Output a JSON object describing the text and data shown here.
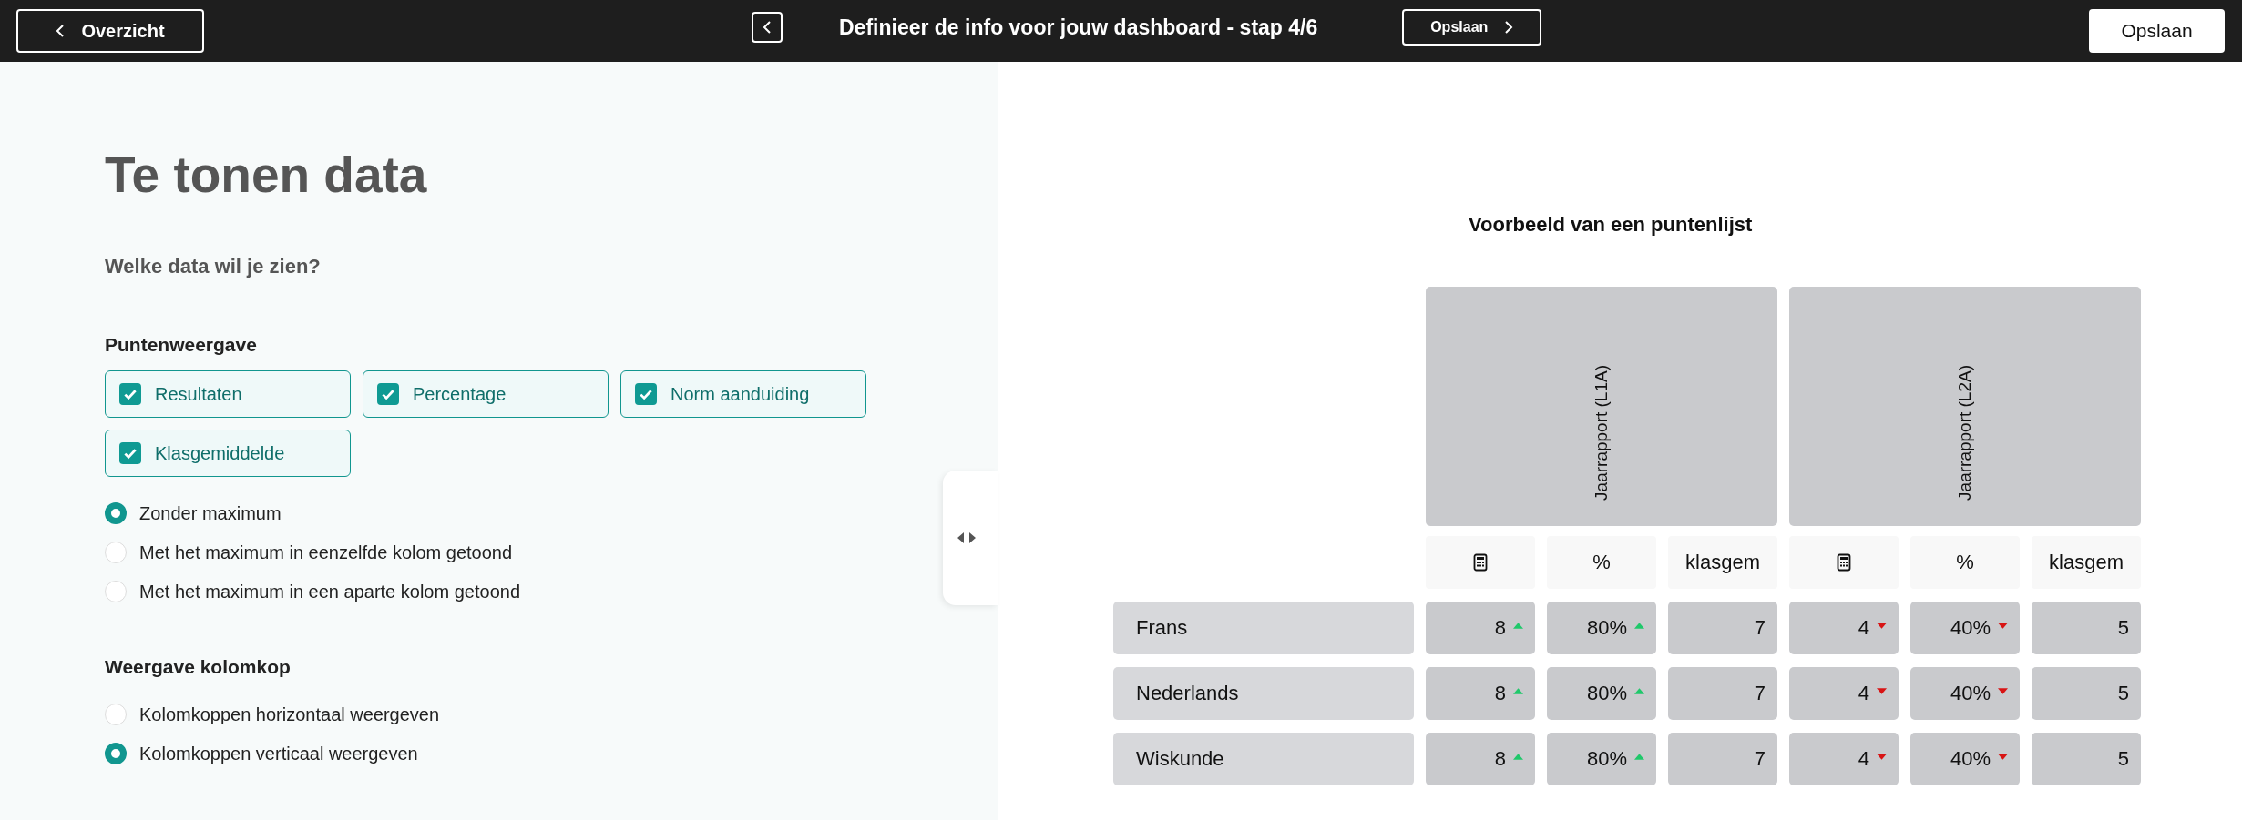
{
  "topbar": {
    "back_label": "Overzicht",
    "title": "Definieer de info voor jouw dashboard - stap 4/6",
    "next_label": "Opslaan",
    "save_label": "Opslaan"
  },
  "settings": {
    "heading": "Te tonen data",
    "question": "Welke data wil je zien?",
    "points_heading": "Puntenweergave",
    "options": [
      {
        "label": "Resultaten",
        "checked": true
      },
      {
        "label": "Percentage",
        "checked": true
      },
      {
        "label": "Norm aanduiding",
        "checked": true
      },
      {
        "label": "Klasgemiddelde",
        "checked": true
      }
    ],
    "max_choices": [
      {
        "label": "Zonder maximum",
        "selected": true
      },
      {
        "label": "Met het maximum in eenzelfde kolom getoond",
        "selected": false
      },
      {
        "label": "Met het maximum in een aparte kolom getoond",
        "selected": false
      }
    ],
    "header_heading": "Weergave kolomkop",
    "header_choices": [
      {
        "label": "Kolomkoppen horizontaal weergeven",
        "selected": false
      },
      {
        "label": "Kolomkoppen verticaal weergeven",
        "selected": true
      }
    ]
  },
  "preview": {
    "title": "Voorbeeld van een puntenlijst",
    "groups": [
      {
        "title": "Jaarrapport (L1A)",
        "columns": [
          {
            "kind": "calculator"
          },
          {
            "kind": "text",
            "label": "%"
          },
          {
            "kind": "text",
            "label": "klasgem"
          }
        ]
      },
      {
        "title": "Jaarrapport (L2A)",
        "columns": [
          {
            "kind": "calculator"
          },
          {
            "kind": "text",
            "label": "%"
          },
          {
            "kind": "text",
            "label": "klasgem"
          }
        ]
      }
    ],
    "rows": [
      {
        "subject": "Frans",
        "cells": [
          {
            "value": "8",
            "rising": true
          },
          {
            "value": "80%",
            "rising": true
          },
          {
            "value": "7"
          },
          {
            "value": "4",
            "rising": false
          },
          {
            "value": "40%",
            "rising": false
          },
          {
            "value": "5"
          }
        ]
      },
      {
        "subject": "Nederlands",
        "cells": [
          {
            "value": "8",
            "rising": true
          },
          {
            "value": "80%",
            "rising": true
          },
          {
            "value": "7"
          },
          {
            "value": "4",
            "rising": false
          },
          {
            "value": "40%",
            "rising": false
          },
          {
            "value": "5"
          }
        ]
      },
      {
        "subject": "Wiskunde",
        "cells": [
          {
            "value": "8",
            "rising": true
          },
          {
            "value": "80%",
            "rising": true
          },
          {
            "value": "7"
          },
          {
            "value": "4",
            "rising": false
          },
          {
            "value": "40%",
            "rising": false
          },
          {
            "value": "5"
          }
        ]
      }
    ]
  }
}
